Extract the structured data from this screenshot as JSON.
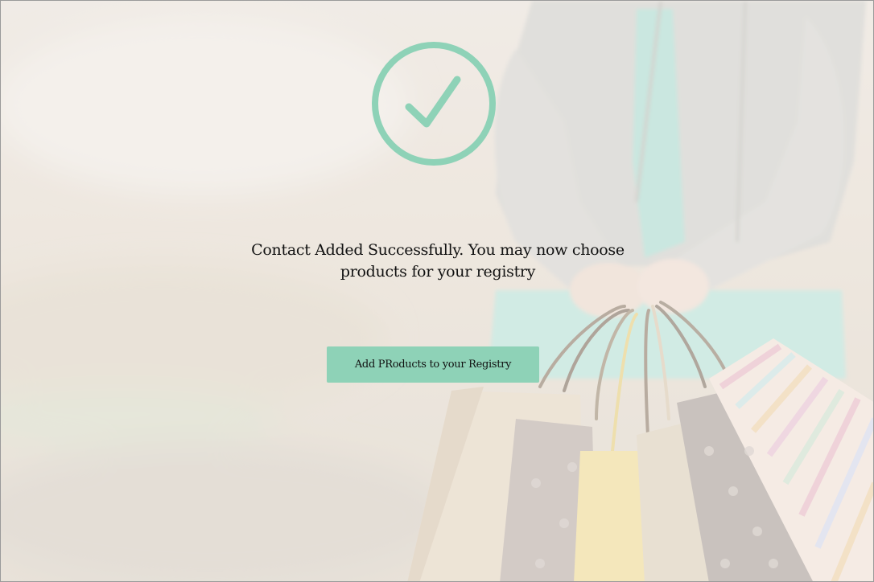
{
  "confirmation": {
    "message": "Contact Added Successfully. You may now choose products for your registry",
    "icon": "checkmark-circle-icon",
    "accent_color": "#8ed2b7"
  },
  "actions": {
    "add_products_label": "Add PRoducts to your Registry"
  },
  "background": {
    "image": "person-holding-shopping-bags"
  }
}
